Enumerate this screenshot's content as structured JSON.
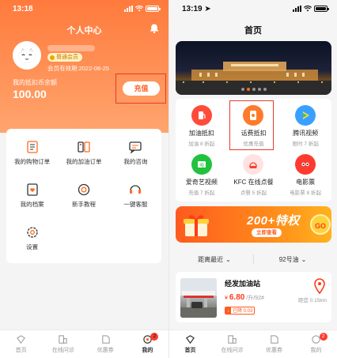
{
  "left": {
    "status": {
      "time": "13:18"
    },
    "title": "个人中心",
    "membership": {
      "badge": "普通会员",
      "expiry": "会员有效期:2022-08-25"
    },
    "balance": {
      "label": "我的抵扣币余额",
      "value": "100.00"
    },
    "recharge_label": "充值",
    "menu": [
      {
        "icon": "order-list-icon",
        "label": "我的购物订单"
      },
      {
        "icon": "fuel-order-icon",
        "label": "我的加油订单"
      },
      {
        "icon": "consult-icon",
        "label": "我的咨询"
      },
      {
        "icon": "profile-file-icon",
        "label": "我的档案"
      },
      {
        "icon": "tutorial-icon",
        "label": "新手教程"
      },
      {
        "icon": "service-icon",
        "label": "一键客服"
      },
      {
        "icon": "settings-icon",
        "label": "设置"
      }
    ],
    "tabs": [
      {
        "label": "首页",
        "icon": "home-icon"
      },
      {
        "label": "在线问诊",
        "icon": "consult-building-icon"
      },
      {
        "label": "优惠券",
        "icon": "coupon-icon"
      },
      {
        "label": "我的",
        "icon": "profile-icon",
        "active": true,
        "badge": "2"
      }
    ]
  },
  "right": {
    "status": {
      "time": "13:19"
    },
    "title": "首页",
    "services": [
      {
        "name": "加油抵扣",
        "sub": "加油 8 折起",
        "color": "#ff4b3a",
        "icon": "fuel-icon"
      },
      {
        "name": "话费抵扣",
        "sub": "优惠充值",
        "color": "#ff7a2a",
        "icon": "phone-bill-icon"
      },
      {
        "name": "腾讯视频",
        "sub": "限时 7 折起",
        "color": "#3aa0ff",
        "icon": "tencent-video-icon"
      },
      {
        "name": "爱奇艺视频",
        "sub": "充值 7 折起",
        "color": "#22c23e",
        "icon": "iqiyi-icon"
      },
      {
        "name": "KFC 在线点餐",
        "sub": "点餐 5 折起",
        "color": "#ff3b30",
        "icon": "kfc-icon"
      },
      {
        "name": "电影票",
        "sub": "电影票 8 折起",
        "color": "#ff3b30",
        "icon": "movie-icon"
      }
    ],
    "promo": {
      "title": "200+特权",
      "button": "立即查看",
      "go": "GO"
    },
    "filters": [
      "距离最近",
      "92号油"
    ],
    "station": {
      "name": "经发加油站",
      "price": "6.80",
      "price_prefix": "¥",
      "unit": "/升/92#",
      "tag_a": "↓",
      "tag_b": "已降 0.03",
      "distance": "距您 0.15km"
    },
    "tabs": [
      {
        "label": "首页",
        "icon": "home-icon",
        "active": true
      },
      {
        "label": "在线问诊",
        "icon": "consult-building-icon"
      },
      {
        "label": "优惠券",
        "icon": "coupon-icon"
      },
      {
        "label": "我的",
        "icon": "profile-icon",
        "badge": "2"
      }
    ]
  },
  "colors": {
    "brand_orange": "#ff7a3c",
    "highlight_red": "#e5392d",
    "price_red": "#ff3b1a"
  }
}
